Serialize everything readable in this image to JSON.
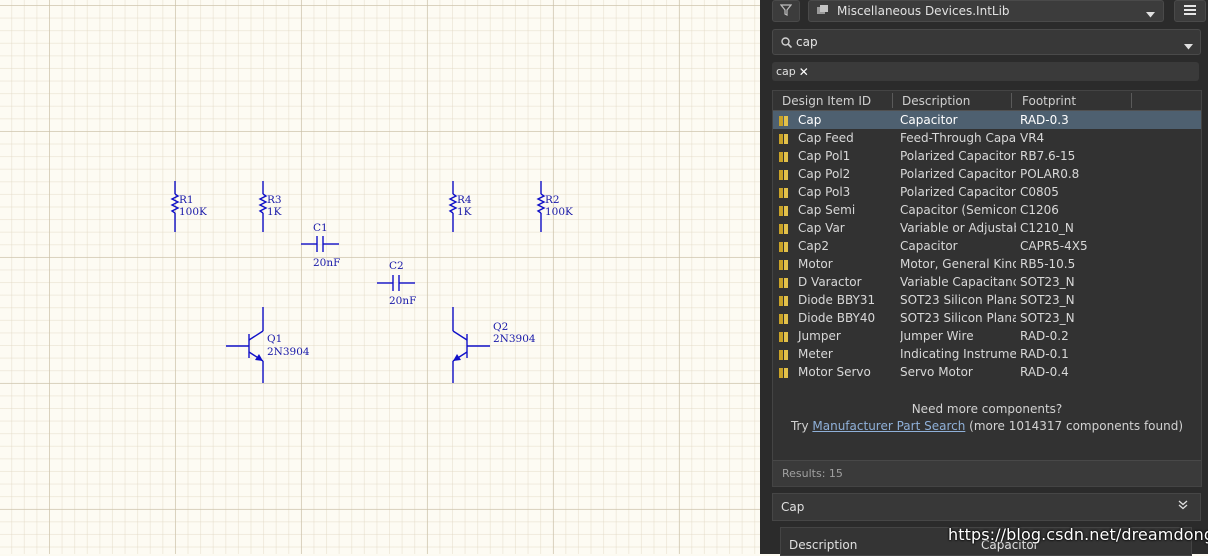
{
  "schematic": {
    "parts": [
      {
        "designator": "R1",
        "value": "100K"
      },
      {
        "designator": "R3",
        "value": "1K"
      },
      {
        "designator": "R4",
        "value": "1K"
      },
      {
        "designator": "R2",
        "value": "100K"
      },
      {
        "designator": "C1",
        "value": "20nF"
      },
      {
        "designator": "C2",
        "value": "20nF"
      },
      {
        "designator": "Q1",
        "value": "2N3904"
      },
      {
        "designator": "Q2",
        "value": "2N3904"
      }
    ]
  },
  "panel": {
    "library": "Miscellaneous Devices.IntLib",
    "search": {
      "value": "cap"
    },
    "filter_chip": "cap",
    "columns": [
      "Design Item ID",
      "Description",
      "Footprint"
    ],
    "rows": [
      {
        "id": "Cap",
        "description": "Capacitor",
        "footprint": "RAD-0.3",
        "selected": true
      },
      {
        "id": "Cap Feed",
        "description": "Feed-Through Capa...",
        "footprint": "VR4"
      },
      {
        "id": "Cap Pol1",
        "description": "Polarized Capacitor (...",
        "footprint": "RB7.6-15"
      },
      {
        "id": "Cap Pol2",
        "description": "Polarized Capacitor (...",
        "footprint": "POLAR0.8"
      },
      {
        "id": "Cap Pol3",
        "description": "Polarized Capacitor (...",
        "footprint": "C0805"
      },
      {
        "id": "Cap Semi",
        "description": "Capacitor (Semicond...",
        "footprint": "C1206"
      },
      {
        "id": "Cap Var",
        "description": "Variable or Adjustabl...",
        "footprint": "C1210_N"
      },
      {
        "id": "Cap2",
        "description": "Capacitor",
        "footprint": "CAPR5-4X5"
      },
      {
        "id": "Motor",
        "description": "Motor, General Kind",
        "footprint": "RB5-10.5"
      },
      {
        "id": "D Varactor",
        "description": "Variable Capacitanc...",
        "footprint": "SOT23_N"
      },
      {
        "id": "Diode BBY31",
        "description": "SOT23 Silicon Planar...",
        "footprint": "SOT23_N"
      },
      {
        "id": "Diode BBY40",
        "description": "SOT23 Silicon Planar...",
        "footprint": "SOT23_N"
      },
      {
        "id": "Jumper",
        "description": "Jumper Wire",
        "footprint": "RAD-0.2"
      },
      {
        "id": "Meter",
        "description": "Indicating Instrument",
        "footprint": "RAD-0.1"
      },
      {
        "id": "Motor Servo",
        "description": "Servo Motor",
        "footprint": "RAD-0.4"
      }
    ],
    "more_question": "Need more components?",
    "more_try": "Try",
    "more_link": "Manufacturer Part Search",
    "more_count": "(more 1014317 components found)",
    "results": "Results: 15",
    "detail": {
      "title": "Cap",
      "desc_label": "Description",
      "desc_value": "Capacitor"
    }
  },
  "watermark": "https://blog.csdn.net/dreamdonghui",
  "colors": {
    "wire": "#1010c8",
    "label": "#1818a8",
    "selection": "#4e6070",
    "link": "#8fb0d8",
    "panel_bg": "#2b2b2b"
  }
}
